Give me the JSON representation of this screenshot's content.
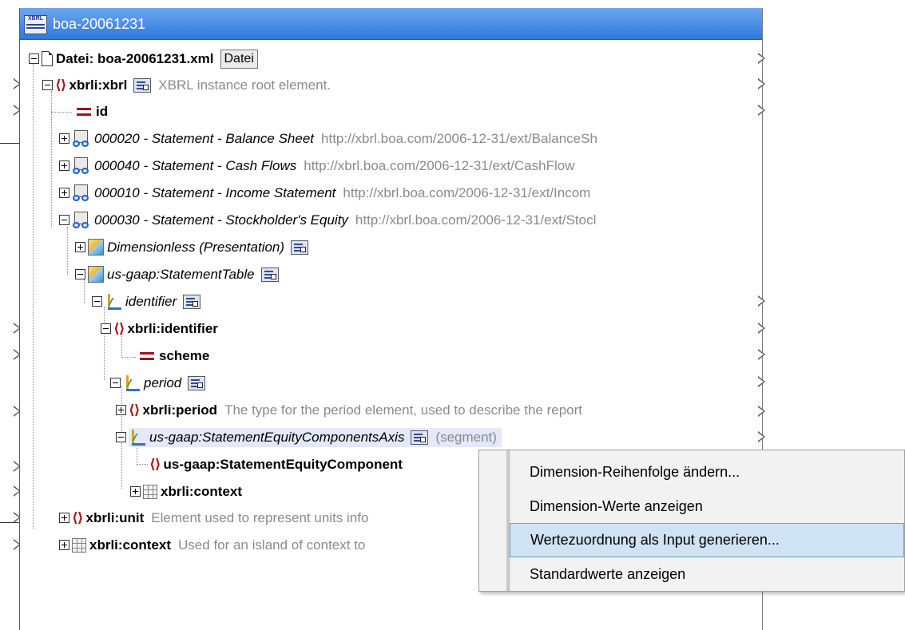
{
  "window": {
    "title": "boa-20061231",
    "icon_text": "XBRL"
  },
  "tree": {
    "root": {
      "label": "Datei: boa-20061231.xml",
      "button": "Datei"
    },
    "xbrl": {
      "label": "xbrli:xbrl",
      "comment": "XBRL instance root element."
    },
    "id": {
      "label": "id"
    },
    "statements": [
      {
        "label": "000020 - Statement - Balance Sheet",
        "url": "http://xbrl.boa.com/2006-12-31/ext/BalanceSh"
      },
      {
        "label": "000040 - Statement - Cash Flows",
        "url": "http://xbrl.boa.com/2006-12-31/ext/CashFlow"
      },
      {
        "label": "000010 - Statement - Income Statement",
        "url": "http://xbrl.boa.com/2006-12-31/ext/Incom"
      },
      {
        "label": "000030 - Statement - Stockholder's Equity",
        "url": "http://xbrl.boa.com/2006-12-31/ext/Stocl"
      }
    ],
    "dimensionless": {
      "label": "Dimensionless (Presentation)"
    },
    "statement_table": {
      "label": "us-gaap:StatementTable"
    },
    "identifier": {
      "label": "identifier"
    },
    "xbrli_identifier": {
      "label": "xbrli:identifier"
    },
    "scheme": {
      "label": "scheme"
    },
    "period": {
      "label": "period"
    },
    "xbrli_period": {
      "label": "xbrli:period",
      "comment": "The type for the period element, used to describe the report"
    },
    "axis": {
      "label": "us-gaap:StatementEquityComponentsAxis",
      "suffix": "(segment)"
    },
    "equity_component": {
      "label": "us-gaap:StatementEquityComponent"
    },
    "context_inner": {
      "label": "xbrli:context"
    },
    "unit": {
      "label": "xbrli:unit",
      "comment": "Element used to represent units info"
    },
    "context_outer": {
      "label": "xbrli:context",
      "comment": "Used for an island of context to"
    }
  },
  "context_menu": {
    "items": [
      "Dimension-Reihenfolge ändern...",
      "Dimension-Werte anzeigen",
      "Wertezuordnung als Input generieren...",
      "Standardwerte anzeigen"
    ],
    "selected_index": 2
  },
  "colors": {
    "title_bar": "#2c79dc",
    "element_icon": "#b0121b",
    "menu_highlight": "#cfe3f5",
    "comment_text": "#8a8a8a"
  }
}
